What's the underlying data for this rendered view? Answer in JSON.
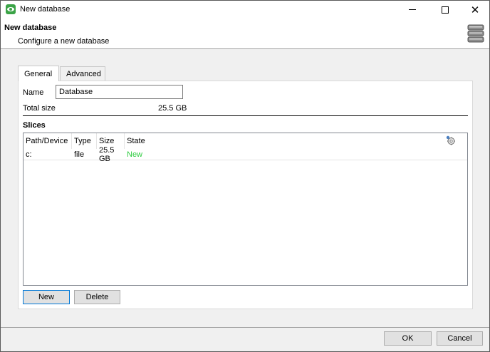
{
  "window": {
    "title": "New database",
    "minimize_icon": "minimize-icon",
    "maximize_icon": "maximize-icon",
    "close_glyph": "✕"
  },
  "header": {
    "title": "New database",
    "subtitle": "Configure a new database",
    "icon": "database-icon"
  },
  "tabs": [
    {
      "label": "General",
      "active": true
    },
    {
      "label": "Advanced",
      "active": false
    }
  ],
  "general": {
    "name_label": "Name",
    "name_value": "Database",
    "total_size_label": "Total size",
    "total_size_value": "25.5 GB",
    "slices_label": "Slices",
    "columns": [
      "Path/Device",
      "Type",
      "Size",
      "State"
    ],
    "rows": [
      {
        "path": "c:",
        "type": "file",
        "size": "25.5 GB",
        "state": "New"
      }
    ],
    "state_new_color": "#2ecc40",
    "new_button": "New",
    "delete_button": "Delete"
  },
  "footer": {
    "ok_label": "OK",
    "cancel_label": "Cancel"
  }
}
